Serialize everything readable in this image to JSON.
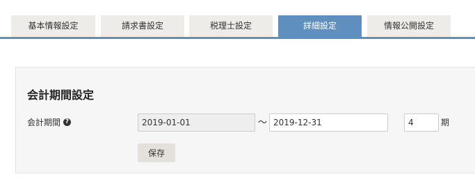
{
  "tabs": [
    {
      "label": "基本情報設定",
      "active": false
    },
    {
      "label": "請求書設定",
      "active": false
    },
    {
      "label": "税理士設定",
      "active": false
    },
    {
      "label": "詳細設定",
      "active": true
    },
    {
      "label": "情報公開設定",
      "active": false
    }
  ],
  "accent_color": "#5e8fbf",
  "section": {
    "title": "会計期間設定",
    "field_label": "会計期間",
    "help_icon": "question-circle-icon",
    "help_glyph": "?",
    "start_date": "2019-01-01",
    "separator": "〜",
    "end_date": "2019-12-31",
    "period_number": "4",
    "period_unit": "期",
    "save_label": "保存"
  }
}
